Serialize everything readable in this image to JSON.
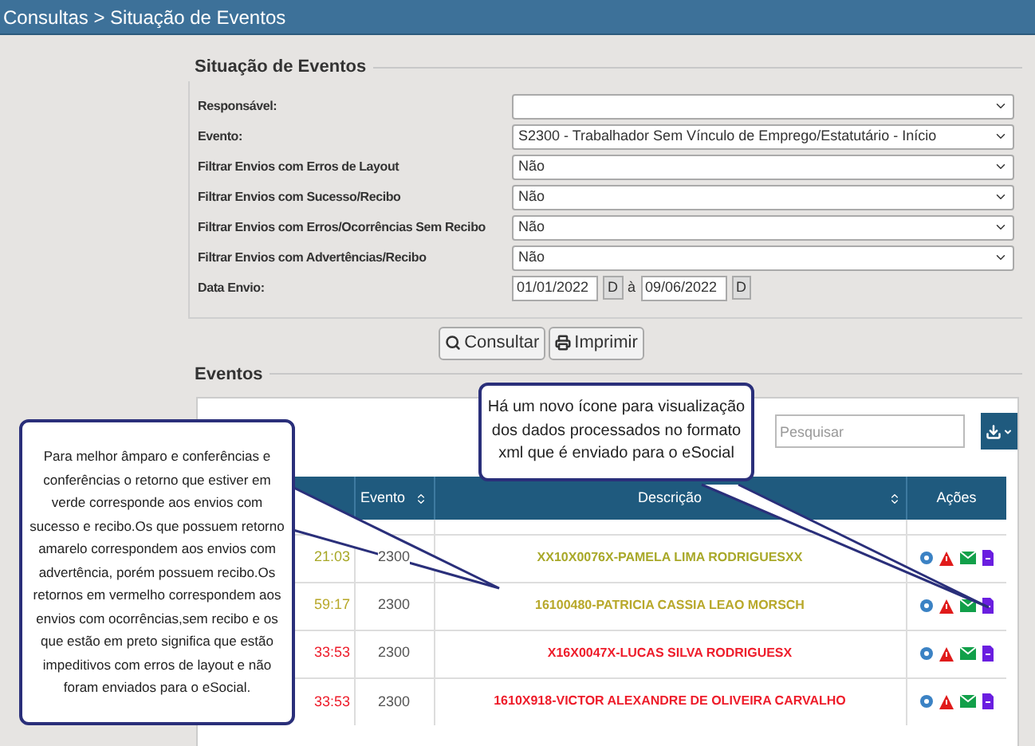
{
  "breadcrumb": "Consultas > Situação de Eventos",
  "filters": {
    "legend": "Situação de Eventos",
    "fields": [
      {
        "kind": "select",
        "label": "Responsável:"
      },
      {
        "kind": "select",
        "label": "Evento:",
        "value": "S2300 - Trabalhador Sem Vínculo de Emprego/Estatutário - Início"
      },
      {
        "kind": "select",
        "label": "Filtrar Envios com Erros de Layout",
        "value": "Não"
      },
      {
        "kind": "select",
        "label": "Filtrar Envios com Sucesso/Recibo",
        "value": "Não"
      },
      {
        "kind": "select",
        "label": "Filtrar Envios com Erros/Ocorrências Sem Recibo",
        "value": "Não"
      },
      {
        "kind": "select",
        "label": "Filtrar Envios com Advertências/Recibo",
        "value": "Não"
      },
      {
        "kind": "date",
        "label": "Data Envio:",
        "from": "01/01/2022",
        "from_button": "D",
        "separator": "à",
        "to": "09/06/2022",
        "to_button": "D"
      }
    ]
  },
  "buttons": [
    "Consultar",
    "Imprimir"
  ],
  "events": {
    "legend": "Eventos",
    "search": {
      "placeholder": "Pesquisar"
    },
    "columns": [
      "Evento",
      "Descrição",
      "Ações"
    ],
    "rows": [
      {
        "time": "21:03",
        "evento": "2300",
        "descricao": "XX10X0076X-PAMELA LIMA RODRIGUESXX",
        "color": "#a8a828"
      },
      {
        "time": "59:17",
        "evento": "2300",
        "descricao": "16100480-PATRICIA CASSIA LEAO MORSCH",
        "color": "#b8a82a"
      },
      {
        "time": "33:53",
        "evento": "2300",
        "descricao": "X16X0047X-LUCAS SILVA RODRIGUESX",
        "color": "#ee1c2a"
      },
      {
        "time": "33:53",
        "evento": "2300",
        "descricao": "1610X918-VICTOR ALEXANDRE DE OLIVEIRA CARVALHO",
        "color": "#ee1c2a"
      }
    ]
  },
  "callouts": [
    {
      "text": "Para melhor âmparo e conferências e conferências o retorno que estiver em verde corresponde aos envios com sucesso e recibo.Os que possuem retorno amarelo correspondem aos envios com advertência, porém possuem recibo.Os retornos em vermelho correspondem aos envios com ocorrências,sem recibo e os que estão em preto significa que estão impeditivos com erros de layout e não foram enviados para o eSocial."
    },
    {
      "text": "Há um novo ícone para visualização dos dados processados no formato xml que é enviado para o eSocial"
    }
  ]
}
